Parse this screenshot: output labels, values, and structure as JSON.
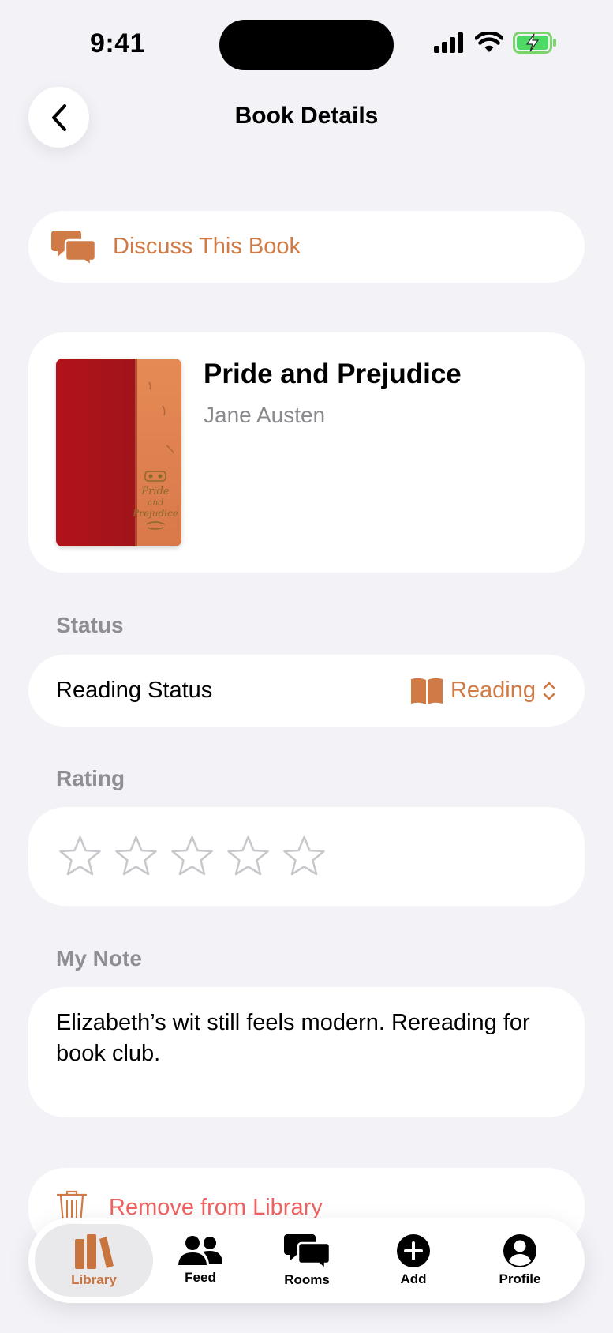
{
  "status_bar": {
    "time": "9:41"
  },
  "nav": {
    "title": "Book Details"
  },
  "discuss": {
    "label": "Discuss This Book"
  },
  "book": {
    "title": "Pride and Prejudice",
    "author": "Jane Austen",
    "cover_text": [
      "Pride",
      "and",
      "Prejudice"
    ]
  },
  "status_section": {
    "header": "Status",
    "row_label": "Reading Status",
    "value": "Reading"
  },
  "rating_section": {
    "header": "Rating",
    "rating": 0,
    "max": 5
  },
  "note_section": {
    "header": "My Note",
    "text": "Elizabeth’s wit still feels modern. Rereading for book club."
  },
  "remove": {
    "label": "Remove from Library"
  },
  "tabbar": {
    "tabs": [
      {
        "label": "Library",
        "icon": "books-icon",
        "active": true
      },
      {
        "label": "Feed",
        "icon": "people-icon",
        "active": false
      },
      {
        "label": "Rooms",
        "icon": "chat-bubbles-icon",
        "active": false
      },
      {
        "label": "Add",
        "icon": "plus-circle-icon",
        "active": false
      },
      {
        "label": "Profile",
        "icon": "person-circle-icon",
        "active": false
      }
    ]
  },
  "colors": {
    "accent": "#d07a45",
    "destructive": "#f06262",
    "background": "#f2f2f7"
  }
}
